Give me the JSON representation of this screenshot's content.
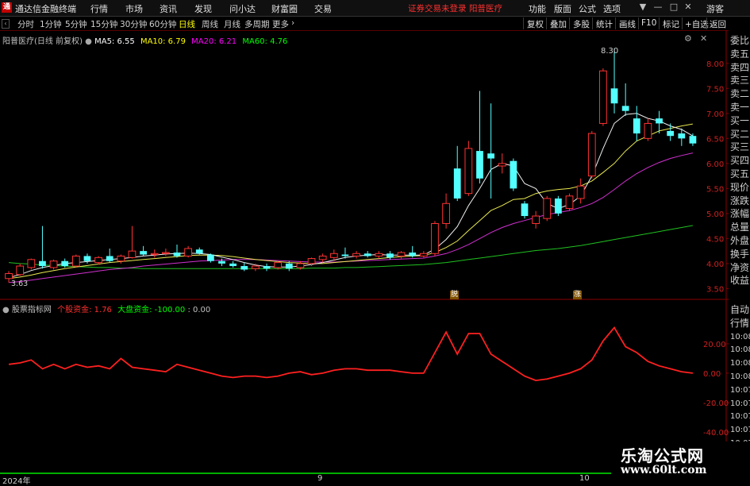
{
  "menubar": {
    "app_title": "通达信金融终端",
    "items": [
      "行情",
      "市场",
      "资讯",
      "发现",
      "问小达",
      "财富圈",
      "交易"
    ],
    "notice": "证券交易未登录",
    "stock_name": "阳普医疗",
    "right_items": [
      "功能",
      "版面",
      "公式",
      "选项"
    ],
    "guest_label": "游客"
  },
  "periodbar": {
    "periods": [
      "分时",
      "1分钟",
      "5分钟",
      "15分钟",
      "30分钟",
      "60分钟",
      "日线",
      "周线",
      "月线",
      "多周期",
      "更多"
    ],
    "active_period": "日线",
    "tools": [
      "复权",
      "叠加",
      "多股",
      "统计",
      "画线",
      "F10",
      "标记",
      "+自选",
      "返回"
    ]
  },
  "main_legend": {
    "title": "阳普医疗(日线 前复权)",
    "ma5": "MA5: 6.55",
    "ma10": "MA10: 6.79",
    "ma20": "MA20: 6.21",
    "ma60": "MA60: 4.76",
    "ma5_color": "#ffffff",
    "ma10_color": "#ffff00",
    "ma20_color": "#ff00ff",
    "ma60_color": "#00ff00"
  },
  "sub_legend": {
    "title": "股票指标网",
    "item1": "个股资金: 1.76",
    "item2": "大盘资金: -100.00",
    "item3": ": 0.00",
    "item1_color": "#ff3030",
    "item2_color": "#00ff00"
  },
  "annotations": {
    "high_label": "8.30",
    "low_label": "3.63",
    "marker1": "脱",
    "marker2": "涨"
  },
  "x_axis": {
    "labels": [
      "2024年",
      "9",
      "10"
    ]
  },
  "side_panel": {
    "labels": [
      "委比",
      "卖五",
      "卖四",
      "卖三",
      "卖二",
      "卖一",
      "买一",
      "买二",
      "买三",
      "买四",
      "买五",
      "现价",
      "涨跌",
      "涨幅",
      "总量",
      "外盘",
      "换手",
      "净资",
      "收益"
    ],
    "sub_labels": [
      "自动",
      "行情",
      "10:08",
      "10:08",
      "10:08",
      "10:08",
      "10:07",
      "10:07",
      "10:07",
      "10:07",
      "10:07"
    ]
  },
  "watermark": {
    "title": "乐淘公式网",
    "url": "www.60lt.com"
  },
  "chart_data": [
    {
      "type": "candlestick",
      "title": "阳普医疗(日线 前复权)",
      "ylim": [
        3.3,
        8.6
      ],
      "yticks": [
        3.5,
        4.0,
        4.5,
        5.0,
        5.5,
        6.0,
        6.5,
        7.0,
        7.5,
        8.0
      ],
      "candles": [
        [
          3.7,
          3.8,
          3.62,
          3.85
        ],
        [
          3.78,
          3.95,
          3.75,
          4.0
        ],
        [
          3.92,
          4.08,
          3.88,
          4.1
        ],
        [
          4.05,
          3.95,
          3.9,
          4.75
        ],
        [
          3.92,
          4.05,
          3.88,
          4.08
        ],
        [
          4.05,
          3.95,
          3.92,
          4.1
        ],
        [
          3.95,
          4.15,
          3.93,
          4.18
        ],
        [
          4.15,
          4.05,
          4.0,
          4.2
        ],
        [
          4.02,
          4.12,
          3.98,
          4.15
        ],
        [
          4.15,
          4.05,
          4.02,
          4.3
        ],
        [
          4.05,
          4.15,
          4.0,
          4.18
        ],
        [
          4.12,
          4.25,
          4.1,
          4.75
        ],
        [
          4.25,
          4.18,
          4.15,
          4.35
        ],
        [
          4.18,
          4.2,
          4.12,
          4.28
        ],
        [
          4.2,
          4.22,
          4.15,
          4.3
        ],
        [
          4.22,
          4.15,
          4.12,
          4.38
        ],
        [
          4.15,
          4.3,
          4.12,
          4.35
        ],
        [
          4.28,
          4.2,
          4.18,
          4.32
        ],
        [
          4.18,
          4.05,
          4.02,
          4.2
        ],
        [
          4.05,
          4.0,
          3.95,
          4.1
        ],
        [
          4.0,
          3.95,
          3.92,
          4.05
        ],
        [
          3.95,
          3.88,
          3.85,
          4.02
        ],
        [
          3.9,
          3.95,
          3.85,
          4.0
        ],
        [
          3.95,
          3.9,
          3.85,
          4.0
        ],
        [
          3.92,
          4.02,
          3.88,
          4.05
        ],
        [
          4.0,
          3.9,
          3.85,
          4.05
        ],
        [
          3.92,
          4.0,
          3.88,
          4.05
        ],
        [
          4.0,
          4.1,
          3.95,
          4.12
        ],
        [
          4.08,
          4.15,
          4.02,
          4.2
        ],
        [
          4.12,
          4.2,
          4.05,
          4.28
        ],
        [
          4.18,
          4.15,
          4.1,
          4.32
        ],
        [
          4.15,
          4.2,
          4.1,
          4.25
        ],
        [
          4.2,
          4.15,
          4.12,
          4.25
        ],
        [
          4.15,
          4.2,
          4.1,
          4.25
        ],
        [
          4.2,
          4.12,
          4.08,
          4.25
        ],
        [
          4.15,
          4.22,
          4.1,
          4.25
        ],
        [
          4.22,
          4.15,
          4.12,
          4.35
        ],
        [
          4.15,
          4.2,
          4.12,
          4.25
        ],
        [
          4.2,
          4.8,
          4.15,
          4.85
        ],
        [
          4.8,
          5.2,
          4.7,
          5.4
        ],
        [
          5.9,
          5.3,
          5.25,
          6.35
        ],
        [
          5.4,
          6.3,
          5.35,
          6.45
        ],
        [
          6.25,
          5.7,
          5.6,
          7.45
        ],
        [
          6.2,
          6.1,
          5.3,
          7.2
        ],
        [
          5.95,
          6.0,
          5.8,
          6.2
        ],
        [
          6.05,
          5.5,
          5.45,
          6.1
        ],
        [
          5.2,
          4.95,
          4.9,
          5.25
        ],
        [
          4.8,
          4.95,
          4.7,
          5.05
        ],
        [
          4.9,
          5.3,
          4.85,
          5.35
        ],
        [
          5.3,
          5.0,
          4.95,
          5.35
        ],
        [
          5.1,
          5.35,
          5.05,
          5.4
        ],
        [
          5.3,
          5.55,
          5.2,
          5.7
        ],
        [
          5.75,
          6.6,
          5.7,
          6.65
        ],
        [
          6.8,
          7.85,
          6.75,
          7.9
        ],
        [
          7.5,
          7.2,
          7.0,
          8.3
        ],
        [
          7.15,
          7.05,
          6.95,
          7.6
        ],
        [
          6.9,
          6.6,
          6.45,
          7.15
        ],
        [
          6.5,
          6.8,
          6.45,
          6.9
        ],
        [
          6.9,
          6.8,
          6.6,
          7.05
        ],
        [
          6.65,
          6.55,
          6.45,
          6.8
        ],
        [
          6.6,
          6.5,
          6.35,
          6.7
        ],
        [
          6.55,
          6.4,
          6.35,
          6.6
        ]
      ],
      "ma5": [
        3.72,
        3.78,
        3.86,
        3.92,
        3.96,
        4.0,
        4.02,
        4.04,
        4.06,
        4.08,
        4.1,
        4.12,
        4.15,
        4.17,
        4.19,
        4.2,
        4.21,
        4.2,
        4.18,
        4.13,
        4.08,
        4.02,
        3.97,
        3.94,
        3.93,
        3.93,
        3.95,
        3.98,
        4.02,
        4.07,
        4.12,
        4.15,
        4.17,
        4.18,
        4.17,
        4.17,
        4.17,
        4.17,
        4.29,
        4.48,
        4.74,
        5.16,
        5.5,
        5.88,
        6.0,
        5.95,
        5.6,
        5.5,
        5.2,
        5.1,
        5.18,
        5.35,
        5.75,
        6.3,
        6.8,
        6.98,
        7.0,
        6.9,
        6.85,
        6.75,
        6.68,
        6.55
      ],
      "ma10": [
        3.7,
        3.73,
        3.77,
        3.82,
        3.86,
        3.9,
        3.93,
        3.96,
        3.99,
        4.02,
        4.04,
        4.06,
        4.08,
        4.1,
        4.12,
        4.14,
        4.16,
        4.17,
        4.17,
        4.16,
        4.14,
        4.11,
        4.08,
        4.06,
        4.04,
        4.02,
        4.01,
        4.0,
        4.0,
        4.02,
        4.04,
        4.06,
        4.08,
        4.1,
        4.12,
        4.14,
        4.15,
        4.16,
        4.22,
        4.32,
        4.45,
        4.66,
        4.86,
        5.06,
        5.16,
        5.28,
        5.3,
        5.4,
        5.45,
        5.48,
        5.5,
        5.55,
        5.65,
        5.82,
        6.0,
        6.25,
        6.45,
        6.55,
        6.65,
        6.7,
        6.75,
        6.79
      ],
      "ma20": [
        3.62,
        3.64,
        3.67,
        3.7,
        3.73,
        3.76,
        3.79,
        3.82,
        3.85,
        3.88,
        3.9,
        3.92,
        3.95,
        3.97,
        3.99,
        4.01,
        4.03,
        4.05,
        4.06,
        4.07,
        4.08,
        4.08,
        4.08,
        4.07,
        4.06,
        4.05,
        4.04,
        4.03,
        4.03,
        4.03,
        4.04,
        4.05,
        4.06,
        4.07,
        4.08,
        4.09,
        4.1,
        4.11,
        4.15,
        4.2,
        4.28,
        4.38,
        4.5,
        4.62,
        4.72,
        4.8,
        4.86,
        4.92,
        4.98,
        5.02,
        5.06,
        5.12,
        5.2,
        5.32,
        5.48,
        5.65,
        5.8,
        5.92,
        6.02,
        6.1,
        6.16,
        6.21
      ],
      "ma60": [
        4.02,
        4.0,
        3.99,
        3.97,
        3.96,
        3.95,
        3.94,
        3.93,
        3.92,
        3.92,
        3.91,
        3.91,
        3.9,
        3.9,
        3.9,
        3.9,
        3.9,
        3.9,
        3.9,
        3.9,
        3.9,
        3.9,
        3.9,
        3.9,
        3.9,
        3.9,
        3.9,
        3.91,
        3.91,
        3.91,
        3.92,
        3.92,
        3.93,
        3.94,
        3.95,
        3.96,
        3.97,
        3.98,
        4.0,
        4.02,
        4.05,
        4.08,
        4.11,
        4.14,
        4.17,
        4.2,
        4.23,
        4.26,
        4.28,
        4.3,
        4.33,
        4.36,
        4.4,
        4.44,
        4.48,
        4.52,
        4.56,
        4.6,
        4.64,
        4.68,
        4.72,
        4.76
      ]
    },
    {
      "type": "line",
      "title": "股票指标网",
      "ylim": [
        -65,
        40
      ],
      "yticks": [
        20.0,
        0.0,
        -20.0,
        -40.0,
        -60.0
      ],
      "series": [
        {
          "name": "个股资金",
          "color": "#ff2020",
          "values": [
            6,
            7,
            9,
            3,
            6,
            3,
            6,
            4,
            5,
            3,
            10,
            4,
            3,
            2,
            1,
            6,
            4,
            2,
            0,
            -2,
            -3,
            -2,
            -2,
            -3,
            -2,
            0,
            1,
            -1,
            0,
            2,
            3,
            3,
            2,
            2,
            2,
            1,
            0,
            0,
            14,
            28,
            13,
            27,
            27,
            13,
            8,
            3,
            -2,
            -5,
            -4,
            -2,
            0,
            3,
            9,
            22,
            31,
            18,
            14,
            8,
            5,
            3,
            1,
            0
          ]
        }
      ]
    }
  ]
}
